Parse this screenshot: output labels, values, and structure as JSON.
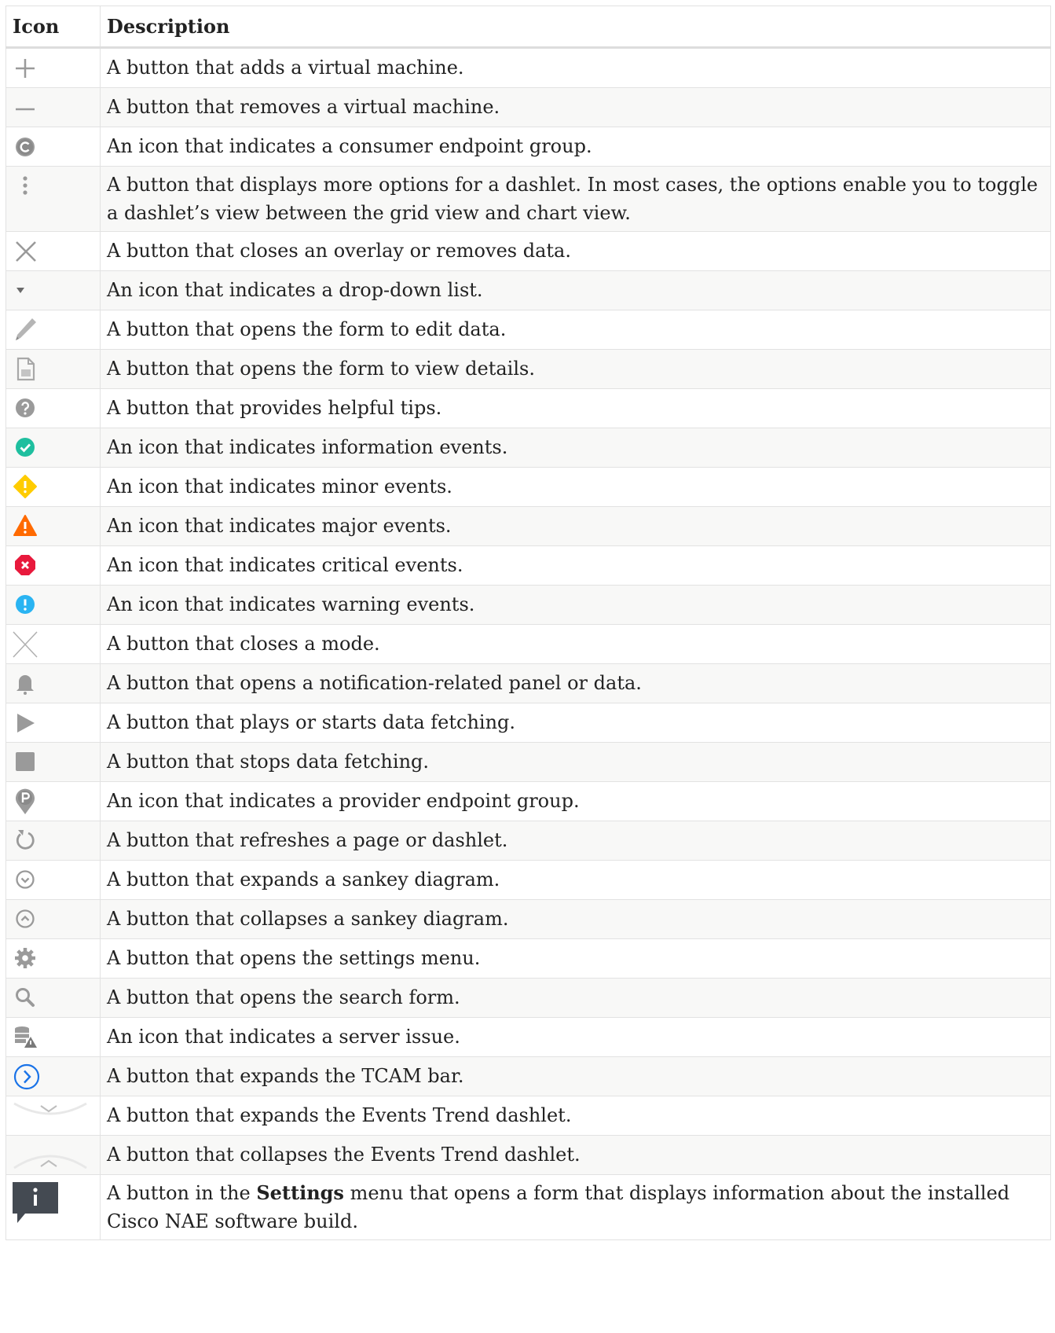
{
  "header": {
    "icon": "Icon",
    "description": "Description"
  },
  "rows": [
    {
      "icon": "plus-icon",
      "description": "A button that adds a virtual machine."
    },
    {
      "icon": "minus-icon",
      "description": "A button that removes a virtual machine."
    },
    {
      "icon": "consumer-c-icon",
      "description": "An icon that indicates a consumer endpoint group."
    },
    {
      "icon": "more-options-icon",
      "description": "A button that displays more options for a dashlet. In most cases, the options enable you to toggle a dashlet’s view between the grid view and chart view."
    },
    {
      "icon": "close-x-icon",
      "description": "A button that closes an overlay or removes data."
    },
    {
      "icon": "dropdown-caret-icon",
      "description": "An icon that indicates a drop-down list."
    },
    {
      "icon": "pencil-icon",
      "description": "A button that opens the form to edit data."
    },
    {
      "icon": "document-icon",
      "description": "A button that opens the form to view details."
    },
    {
      "icon": "help-icon",
      "description": "A button that provides helpful tips."
    },
    {
      "icon": "info-check-icon",
      "description": "An icon that indicates information events."
    },
    {
      "icon": "minor-diamond-icon",
      "description": "An icon that indicates minor events."
    },
    {
      "icon": "major-triangle-icon",
      "description": "An icon that indicates major events."
    },
    {
      "icon": "critical-x-icon",
      "description": "An icon that indicates critical events."
    },
    {
      "icon": "warning-exclamation-icon",
      "description": "An icon that indicates warning events."
    },
    {
      "icon": "close-mode-icon",
      "description": "A button that closes a mode."
    },
    {
      "icon": "bell-icon",
      "description": "A button that opens a notification-related panel or data."
    },
    {
      "icon": "play-icon",
      "description": "A button that plays or starts data fetching."
    },
    {
      "icon": "stop-icon",
      "description": "A button that stops data fetching."
    },
    {
      "icon": "provider-pin-icon",
      "description": "An icon that indicates a provider endpoint group."
    },
    {
      "icon": "refresh-icon",
      "description": "A button that refreshes a page or dashlet."
    },
    {
      "icon": "expand-circle-icon",
      "description": "A button that expands a sankey diagram."
    },
    {
      "icon": "collapse-circle-icon",
      "description": "A button that collapses a sankey diagram."
    },
    {
      "icon": "gear-icon",
      "description": "A button that opens the settings menu."
    },
    {
      "icon": "search-icon",
      "description": "A button that opens the search form."
    },
    {
      "icon": "server-issue-icon",
      "description": "An icon that indicates a server issue."
    },
    {
      "icon": "tcam-expand-icon",
      "description": "A button that expands the TCAM bar."
    },
    {
      "icon": "trend-expand-icon",
      "description": "A button that expands the Events Trend dashlet."
    },
    {
      "icon": "trend-collapse-icon",
      "description": "A button that collapses the Events Trend dashlet."
    },
    {
      "icon": "about-info-icon",
      "description_before": "A button in the ",
      "description_bold": "Settings",
      "description_after": " menu that opens a form that displays information about the installed Cisco NAE software build."
    }
  ],
  "colors": {
    "icon_gray": "#9a9a9a",
    "info_green": "#1fbf9f",
    "minor_yellow": "#ffcc00",
    "major_orange": "#ff6a00",
    "critical_red": "#e8193c",
    "warning_blue": "#2ab4f2",
    "link_blue": "#1a73e8",
    "about_dark": "#444a52"
  }
}
